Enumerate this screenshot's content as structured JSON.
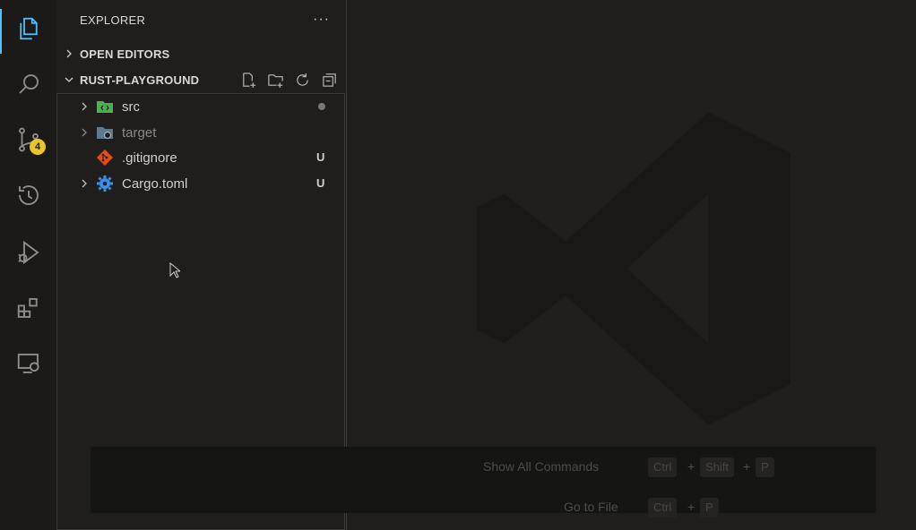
{
  "activity_bar": {
    "items": [
      {
        "name": "explorer-icon",
        "active": true
      },
      {
        "name": "search-icon"
      },
      {
        "name": "source-control-icon",
        "badge": "4"
      },
      {
        "name": "timeline-icon"
      },
      {
        "name": "run-debug-icon"
      },
      {
        "name": "extensions-icon"
      },
      {
        "name": "remote-explorer-icon"
      }
    ]
  },
  "sidebar": {
    "title": "EXPLORER",
    "more": "···",
    "open_editors": "OPEN EDITORS",
    "project": "RUST-PLAYGROUND",
    "files": [
      {
        "label": "src",
        "icon": "folder-src-icon",
        "status": "",
        "expandable": true
      },
      {
        "label": "target",
        "icon": "folder-target-icon",
        "status": "",
        "expandable": true
      },
      {
        "label": ".gitignore",
        "icon": "git-icon",
        "status": "U",
        "expandable": false
      },
      {
        "label": "Cargo.toml",
        "icon": "gear-icon",
        "status": "U",
        "expandable": true
      }
    ]
  },
  "editor": {
    "hints": [
      {
        "label": "Show All Commands",
        "keys": [
          "Ctrl",
          "Shift",
          "P"
        ]
      },
      {
        "label": "Go to File",
        "keys": [
          "Ctrl",
          "P"
        ]
      }
    ]
  },
  "colors": {
    "accent": "#4fc1ff",
    "badge": "#e8c62a",
    "git": "#e64a19",
    "toml": "#3b8fe8",
    "src_folder": "#4caf50"
  }
}
